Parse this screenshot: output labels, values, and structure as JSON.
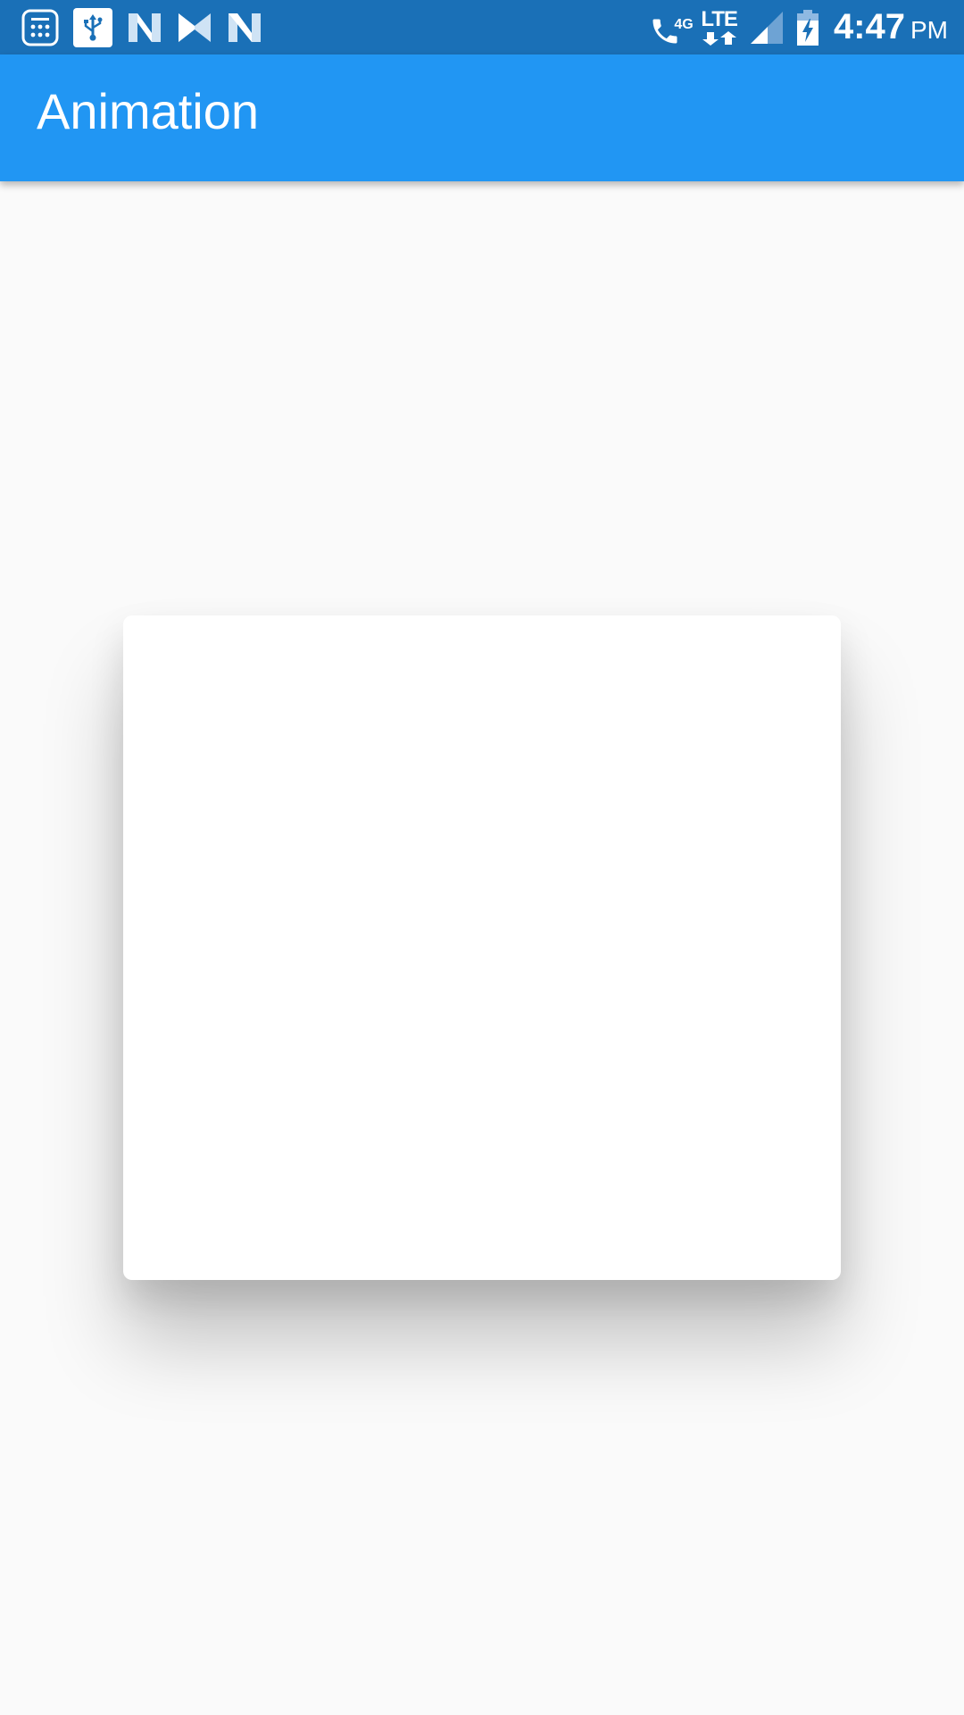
{
  "status_bar": {
    "time": "4:47",
    "ampm": "PM",
    "network_type": "4G",
    "data_label": "LTE",
    "left_icons": [
      "calculator-icon",
      "usb-icon",
      "n-logo-icon",
      "n-logo-icon",
      "n-logo-icon"
    ],
    "right_icons": [
      "wifi-call-icon",
      "lte-data-icon",
      "signal-icon",
      "battery-charging-icon"
    ],
    "colors": {
      "background": "#1a70b7",
      "foreground": "#ffffff"
    }
  },
  "app_bar": {
    "title": "Animation",
    "background": "#2196f3"
  },
  "main": {
    "background": "#fafafa",
    "card": {
      "background": "#ffffff"
    }
  }
}
